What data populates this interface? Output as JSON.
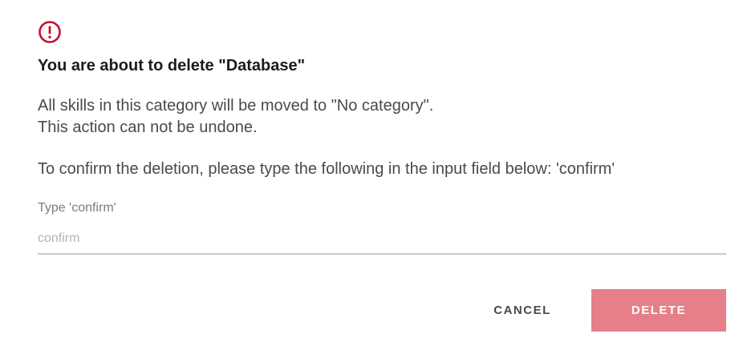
{
  "dialog": {
    "icon": "exclamation-circle-icon",
    "title": "You are about to delete \"Database\"",
    "message_line1": "All skills in this category will be moved to \"No category\".",
    "message_line2": "This action can not be undone.",
    "instruction": "To confirm the deletion, please type the following in the input field below: 'confirm'",
    "field": {
      "label": "Type 'confirm'",
      "placeholder": "confirm",
      "value": ""
    },
    "buttons": {
      "cancel_label": "CANCEL",
      "delete_label": "DELETE"
    }
  },
  "colors": {
    "icon": "#c8102e",
    "delete_button_bg": "#e67f89",
    "underline": "#c9c9c9"
  }
}
